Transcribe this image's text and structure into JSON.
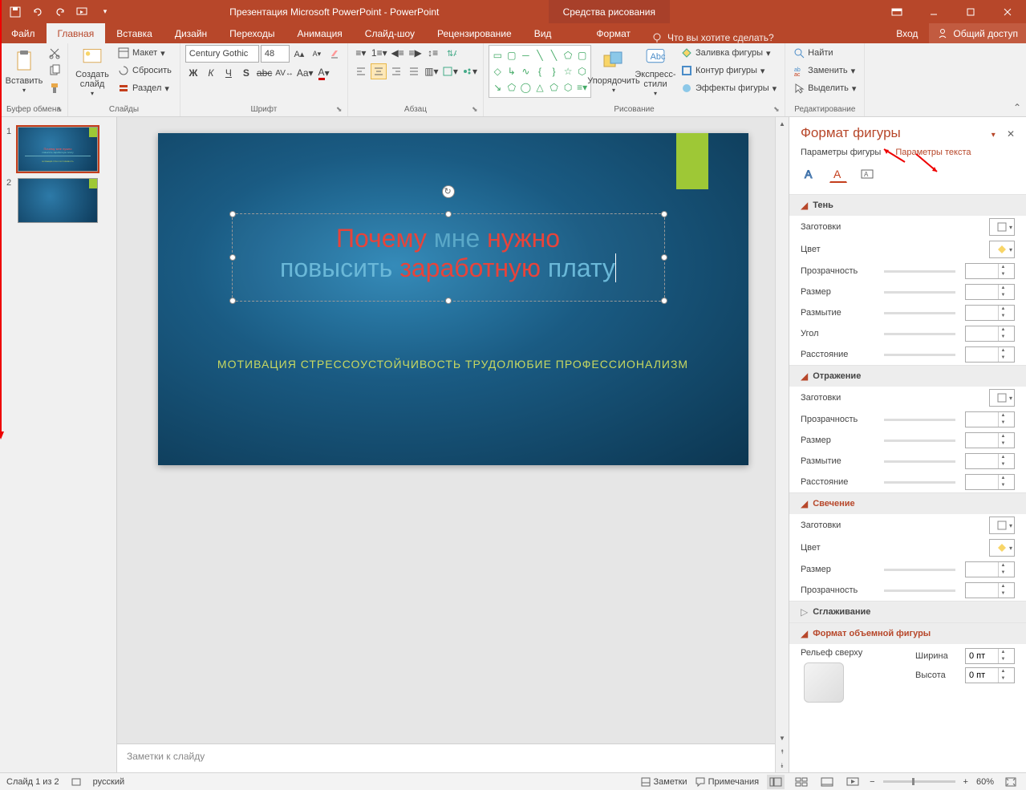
{
  "title": "Презентация Microsoft PowerPoint - PowerPoint",
  "contextual_title": "Средства рисования",
  "auth": {
    "login": "Вход",
    "share": "Общий доступ"
  },
  "tabs": [
    "Файл",
    "Главная",
    "Вставка",
    "Дизайн",
    "Переходы",
    "Анимация",
    "Слайд-шоу",
    "Рецензирование",
    "Вид"
  ],
  "contextual_tab": "Формат",
  "tell_me": "Что вы хотите сделать?",
  "ribbon": {
    "clipboard": {
      "paste": "Вставить",
      "label": "Буфер обмена"
    },
    "slides": {
      "new_slide": "Создать слайд",
      "layout": "Макет",
      "reset": "Сбросить",
      "section": "Раздел",
      "label": "Слайды"
    },
    "font": {
      "family": "Century Gothic",
      "size": "48",
      "label": "Шрифт"
    },
    "paragraph": {
      "label": "Абзац"
    },
    "drawing": {
      "arrange": "Упорядочить",
      "quick_styles": "Экспресс-стили",
      "fill": "Заливка фигуры",
      "outline": "Контур фигуры",
      "effects": "Эффекты фигуры",
      "label": "Рисование"
    },
    "editing": {
      "find": "Найти",
      "replace": "Заменить",
      "select": "Выделить",
      "label": "Редактирование"
    }
  },
  "slide": {
    "title_line1": {
      "w1": "Почему",
      "w2": "мне",
      "w3": "нужно"
    },
    "title_line2": {
      "w1": "повысить",
      "w2": "заработную",
      "w3": "плату"
    },
    "subtitle": "МОТИВАЦИЯ СТРЕССОУСТОЙЧИВОСТЬ ТРУДОЛЮБИЕ ПРОФЕССИОНАЛИЗМ"
  },
  "notes_placeholder": "Заметки к слайду",
  "format_pane": {
    "title": "Формат фигуры",
    "tab_shape": "Параметры фигуры",
    "tab_text": "Параметры текста",
    "sections": {
      "shadow": {
        "title": "Тень",
        "presets": "Заготовки",
        "color": "Цвет",
        "transparency": "Прозрачность",
        "size": "Размер",
        "blur": "Размытие",
        "angle": "Угол",
        "distance": "Расстояние"
      },
      "reflection": {
        "title": "Отражение",
        "presets": "Заготовки",
        "transparency": "Прозрачность",
        "size": "Размер",
        "blur": "Размытие",
        "distance": "Расстояние"
      },
      "glow": {
        "title": "Свечение",
        "presets": "Заготовки",
        "color": "Цвет",
        "size": "Размер",
        "transparency": "Прозрачность"
      },
      "soft_edges": {
        "title": "Сглаживание"
      },
      "threed": {
        "title": "Формат объемной фигуры",
        "top_bevel": "Рельеф сверху",
        "width": "Ширина",
        "height": "Высота",
        "width_val": "0 пт",
        "height_val": "0 пт"
      }
    }
  },
  "status": {
    "slide_of": "Слайд 1 из 2",
    "lang": "русский",
    "notes": "Заметки",
    "comments": "Примечания",
    "zoom": "60%"
  }
}
